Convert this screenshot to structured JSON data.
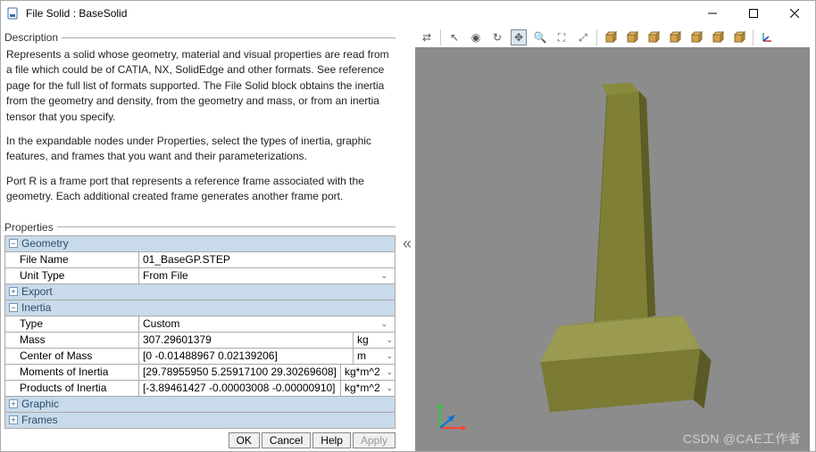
{
  "window": {
    "title": "File Solid : BaseSolid"
  },
  "description": {
    "heading": "Description",
    "para1": "Represents a solid whose geometry, material and visual properties are read from a file which could be of CATIA, NX, SolidEdge and other formats. See reference page for the full list of formats supported. The File Solid block obtains the inertia from the geometry and density, from the geometry and mass, or from an inertia tensor that you specify.",
    "para2": "In the expandable nodes under Properties, select the types of inertia, graphic features, and frames that you want and their parameterizations.",
    "para3": "Port R is a frame port that represents a reference frame associated with the geometry. Each additional created frame generates another frame port."
  },
  "properties_heading": "Properties",
  "sections": {
    "geometry": {
      "label": "Geometry",
      "expanded": true
    },
    "export": {
      "label": "Export",
      "expanded": false
    },
    "inertia": {
      "label": "Inertia",
      "expanded": true
    },
    "graphic": {
      "label": "Graphic",
      "expanded": false
    },
    "frames": {
      "label": "Frames",
      "expanded": false
    }
  },
  "geometry": {
    "fileNameLabel": "File Name",
    "fileName": "01_BaseGP.STEP",
    "unitTypeLabel": "Unit Type",
    "unitType": "From File"
  },
  "inertia": {
    "typeLabel": "Type",
    "type": "Custom",
    "massLabel": "Mass",
    "mass": "307.29601379",
    "massUnit": "kg",
    "comLabel": "Center of Mass",
    "com": "[0 -0.01488967 0.02139206]",
    "comUnit": "m",
    "moiLabel": "Moments of Inertia",
    "moi": "[29.78955950 5.25917100 29.30269608]",
    "moiUnit": "kg*m^2",
    "poiLabel": "Products of Inertia",
    "poi": "[-3.89461427 -0.00003008 -0.00000910]",
    "poiUnit": "kg*m^2"
  },
  "buttons": {
    "ok": "OK",
    "cancel": "Cancel",
    "help": "Help",
    "apply": "Apply"
  },
  "watermark": "CSDN @CAE工作者",
  "toolbar_icons": [
    "sync-icon",
    "cursor-icon",
    "orbit-icon",
    "roll-icon",
    "pan-icon",
    "zoom-icon",
    "zoom-region-icon",
    "fit-icon",
    "iso-icon",
    "front-icon",
    "back-icon",
    "top-icon",
    "bottom-icon",
    "left-icon",
    "right-icon",
    "axes-icon"
  ]
}
